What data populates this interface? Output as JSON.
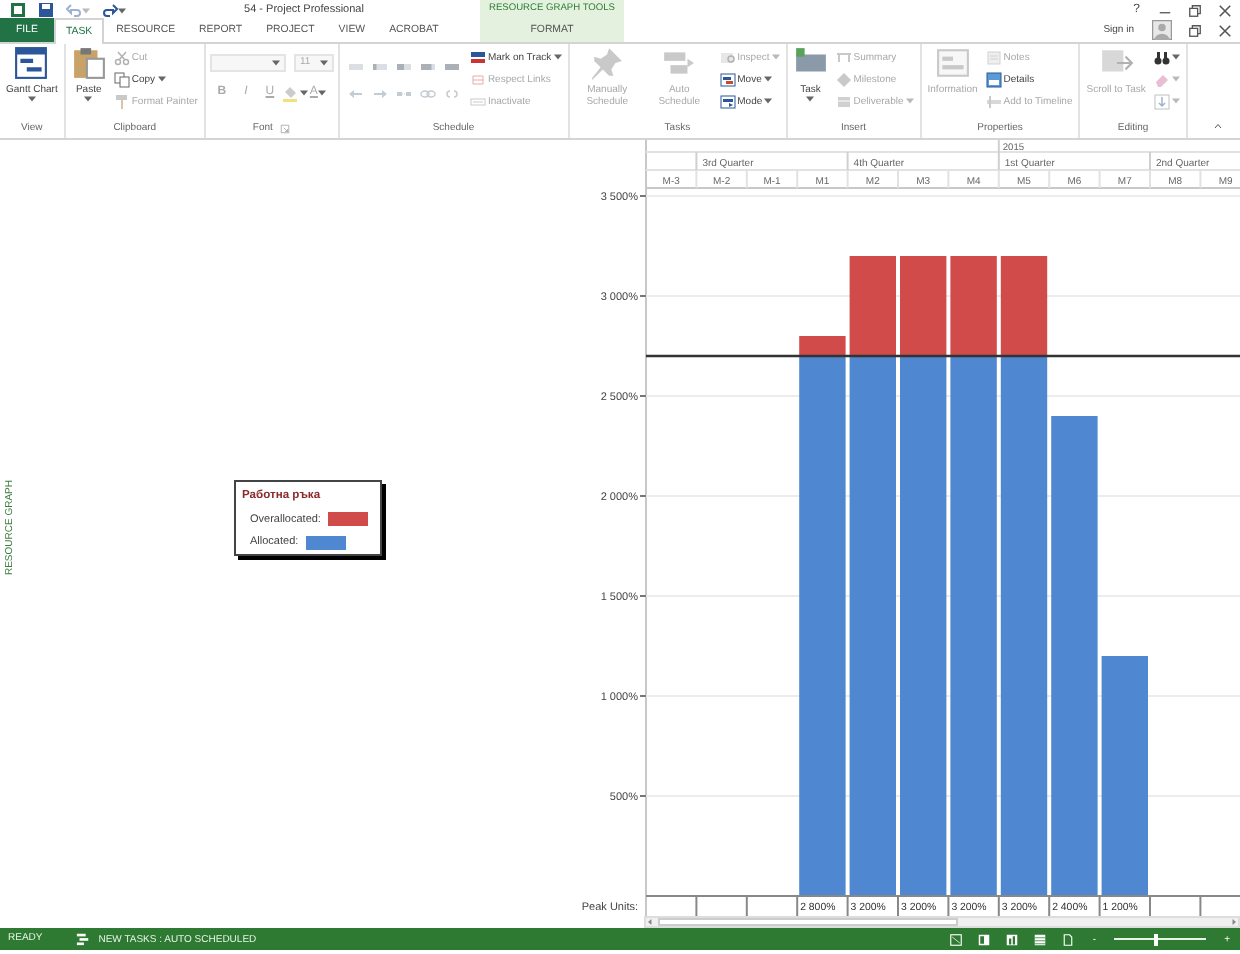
{
  "title_bar": {
    "quick_access": [
      {
        "disabled": false
      },
      {
        "disabled": false
      },
      {
        "disabled": true
      },
      {
        "disabled": false
      }
    ],
    "title": "54 - Project Professional",
    "contextual_label": "RESOURCE GRAPH TOOLS",
    "help": "?"
  },
  "tabs": [
    {
      "label": "FILE",
      "kind": "file",
      "selected": false
    },
    {
      "label": "TASK",
      "kind": "normal",
      "selected": true
    },
    {
      "label": "RESOURCE",
      "kind": "normal",
      "selected": false
    },
    {
      "label": "REPORT",
      "kind": "normal",
      "selected": false
    },
    {
      "label": "PROJECT",
      "kind": "normal",
      "selected": false
    },
    {
      "label": "VIEW",
      "kind": "normal",
      "selected": false
    },
    {
      "label": "ACROBAT",
      "kind": "normal",
      "selected": false
    },
    {
      "label": "FORMAT",
      "kind": "contextual",
      "selected": false
    }
  ],
  "account": {
    "label": "Sign in"
  },
  "ribbon": {
    "groups": [
      {
        "label": "View",
        "launcher": false,
        "items": [
          {
            "kind": "large",
            "label": "Gantt Chart",
            "dropdown": true,
            "disabled": false
          }
        ]
      },
      {
        "label": "Clipboard",
        "launcher": false,
        "items": [
          {
            "kind": "large",
            "label": "Paste",
            "dropdown": true,
            "disabled": false
          },
          {
            "kind": "small",
            "label": "Cut",
            "dropdown": false,
            "disabled": true
          },
          {
            "kind": "small",
            "label": "Copy",
            "dropdown": true,
            "disabled": false
          },
          {
            "kind": "small",
            "label": "Format Painter",
            "dropdown": false,
            "disabled": true
          }
        ]
      },
      {
        "label": "Font",
        "launcher": true,
        "items": [
          {
            "kind": "combo",
            "disabled": true
          },
          {
            "kind": "combo",
            "value": "11",
            "disabled": true
          },
          {
            "kind": "tool",
            "glyph": "B",
            "dropdown": false,
            "disabled": true
          },
          {
            "kind": "tool",
            "glyph": "I",
            "dropdown": false,
            "disabled": true
          },
          {
            "kind": "tool",
            "glyph": "U",
            "dropdown": false,
            "disabled": true
          },
          {
            "kind": "tool",
            "dropdown": true,
            "disabled": true
          },
          {
            "kind": "tool",
            "glyph": "A",
            "dropdown": true,
            "disabled": true
          }
        ]
      },
      {
        "label": "Schedule",
        "launcher": false,
        "items": [
          {
            "kind": "tool",
            "dropdown": false,
            "disabled": true
          },
          {
            "kind": "tool",
            "dropdown": false,
            "disabled": true
          },
          {
            "kind": "tool",
            "dropdown": false,
            "disabled": true
          },
          {
            "kind": "tool",
            "dropdown": false,
            "disabled": true
          },
          {
            "kind": "tool",
            "dropdown": false,
            "disabled": true
          },
          {
            "kind": "tool",
            "dropdown": false,
            "disabled": true
          },
          {
            "kind": "tool",
            "dropdown": false,
            "disabled": true
          },
          {
            "kind": "tool",
            "dropdown": false,
            "disabled": true
          },
          {
            "kind": "tool",
            "dropdown": false,
            "disabled": true
          },
          {
            "kind": "tool",
            "dropdown": false,
            "disabled": true
          },
          {
            "kind": "small",
            "label": "Mark on Track",
            "dropdown": true,
            "disabled": false
          },
          {
            "kind": "small",
            "label": "Respect Links",
            "dropdown": false,
            "disabled": true
          },
          {
            "kind": "small",
            "label": "Inactivate",
            "dropdown": false,
            "disabled": true
          }
        ]
      },
      {
        "label": "Tasks",
        "launcher": false,
        "items": [
          {
            "kind": "large",
            "label": "Manually Schedule",
            "dropdown": false,
            "disabled": true
          },
          {
            "kind": "large",
            "label": "Auto Schedule",
            "dropdown": false,
            "disabled": true
          },
          {
            "kind": "small",
            "label": "Inspect",
            "dropdown": true,
            "disabled": true
          },
          {
            "kind": "small",
            "label": "Move",
            "dropdown": true,
            "disabled": false
          },
          {
            "kind": "small",
            "label": "Mode",
            "dropdown": true,
            "disabled": false
          }
        ]
      },
      {
        "label": "Insert",
        "launcher": false,
        "items": [
          {
            "kind": "large",
            "label": "Task",
            "dropdown": true,
            "disabled": false
          },
          {
            "kind": "small",
            "label": "Summary",
            "dropdown": false,
            "disabled": true
          },
          {
            "kind": "small",
            "label": "Milestone",
            "dropdown": false,
            "disabled": true
          },
          {
            "kind": "small",
            "label": "Deliverable",
            "dropdown": true,
            "disabled": true
          }
        ]
      },
      {
        "label": "Properties",
        "launcher": false,
        "items": [
          {
            "kind": "large",
            "label": "Information",
            "dropdown": false,
            "disabled": true
          },
          {
            "kind": "small",
            "label": "Notes",
            "dropdown": false,
            "disabled": true
          },
          {
            "kind": "small",
            "label": "Details",
            "dropdown": false,
            "disabled": false
          },
          {
            "kind": "small",
            "label": "Add to Timeline",
            "dropdown": false,
            "disabled": true
          }
        ]
      },
      {
        "label": "Editing",
        "launcher": false,
        "items": [
          {
            "kind": "large",
            "label": "Scroll to Task",
            "dropdown": false,
            "disabled": true
          },
          {
            "kind": "small",
            "dropdown": true,
            "disabled": false
          },
          {
            "kind": "small",
            "dropdown": true,
            "disabled": true
          },
          {
            "kind": "small",
            "dropdown": true,
            "disabled": true
          }
        ]
      }
    ]
  },
  "view_bar": {
    "label": "RESOURCE GRAPH"
  },
  "timescale": {
    "years": [
      "2015"
    ],
    "quarters": [
      "3rd Quarter",
      "4th Quarter",
      "1st Quarter",
      "2nd Quarter"
    ]
  },
  "chart_data": {
    "type": "bar",
    "stacked": true,
    "grid": true,
    "legend": {
      "title": "Работна ръка"
    },
    "categories": [
      "M-3",
      "M-2",
      "M-1",
      "M1",
      "M2",
      "M3",
      "M4",
      "M5",
      "M6",
      "M7",
      "M8",
      "M9"
    ],
    "series": [
      {
        "name": "Allocated:",
        "color": "#4f88d0",
        "values": [
          null,
          null,
          null,
          2700,
          2700,
          2700,
          2700,
          2700,
          2400,
          1200,
          null,
          null
        ]
      },
      {
        "name": "Overallocated:",
        "color": "#d24b4b",
        "values": [
          null,
          null,
          null,
          100,
          500,
          500,
          500,
          500,
          null,
          null,
          null,
          null
        ]
      }
    ],
    "ylim": [
      0,
      3500
    ],
    "yticks": [
      {
        "value": 500,
        "label": "500%"
      },
      {
        "value": 1000,
        "label": "1 000%"
      },
      {
        "value": 1500,
        "label": "1 500%"
      },
      {
        "value": 2000,
        "label": "2 000%"
      },
      {
        "value": 2500,
        "label": "2 500%"
      },
      {
        "value": 3000,
        "label": "3 000%"
      },
      {
        "value": 3500,
        "label": "3 500%"
      }
    ],
    "ref_lines": [
      {
        "axis": "y",
        "value": 2700
      }
    ]
  },
  "peak_units": {
    "label": "Peak Units:",
    "cells": [
      "2 800%",
      "3 200%",
      "3 200%",
      "3 200%",
      "3 200%",
      "2 400%",
      "1 200%"
    ]
  },
  "status_bar": {
    "mode": "READY",
    "new_tasks": "NEW TASKS : AUTO SCHEDULED",
    "zoom": {
      "out": "-",
      "in": "+",
      "level": 0.45
    }
  }
}
